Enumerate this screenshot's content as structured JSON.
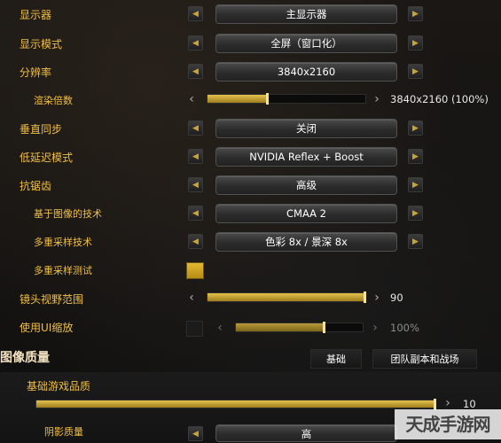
{
  "settings": [
    {
      "label": "显示器",
      "value": "主显示器"
    },
    {
      "label": "显示模式",
      "value": "全屏（窗口化）"
    },
    {
      "label": "分辨率",
      "value": "3840x2160"
    },
    {
      "label": "渲染倍数",
      "value": "3840x2160 (100%)",
      "level": 0.38
    },
    {
      "label": "垂直同步",
      "value": "关闭"
    },
    {
      "label": "低延迟模式",
      "value": "NVIDIA Reflex + Boost"
    },
    {
      "label": "抗锯齿",
      "value": "高级"
    },
    {
      "label": "基于图像的技术",
      "value": "CMAA 2"
    },
    {
      "label": "多重采样技术",
      "value": "色彩 8x / 景深 8x"
    },
    {
      "label": "多重采样测试",
      "checked": true
    },
    {
      "label": "镜头视野范围",
      "value": "90",
      "level": 1.0
    },
    {
      "label": "使用UI缩放",
      "value": "100%",
      "level": 0.7,
      "checked": false
    }
  ],
  "section": {
    "title": "图像质量",
    "tabs": [
      "基础",
      "团队副本和战场"
    ]
  },
  "quality": {
    "label": "基础游戏品质",
    "value": "10",
    "level": 1.0
  },
  "shadow": {
    "label": "阴影质量",
    "value": "高"
  },
  "watermark": "天成手游网",
  "icons": {
    "left": "◀",
    "right": "▶",
    "chev_left": "‹",
    "chev_right": "›"
  }
}
